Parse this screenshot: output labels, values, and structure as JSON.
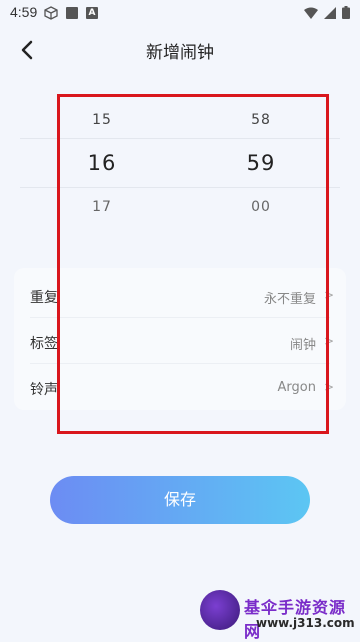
{
  "status_bar": {
    "time": "4:59",
    "icons_left": [
      "cube-icon",
      "square-icon",
      "a-icon"
    ],
    "icons_right": [
      "wifi-icon",
      "signal-icon",
      "battery-icon"
    ],
    "a_icon_letter": "A"
  },
  "header": {
    "title": "新增闹钟",
    "back_icon": "chevron-left-icon"
  },
  "time_picker": {
    "hours": {
      "prev": "15",
      "selected": "16",
      "next": "17"
    },
    "minutes": {
      "prev": "58",
      "selected": "59",
      "next": "00"
    }
  },
  "settings": {
    "repeat": {
      "label": "重复",
      "value": "永不重复"
    },
    "tag": {
      "label": "标签",
      "value": "闹钟"
    },
    "ringtone": {
      "label": "铃声",
      "value": "Argon"
    },
    "chevron": ">"
  },
  "save_button": {
    "label": "保存"
  },
  "watermark": {
    "title": "基伞手游资源网",
    "url": "www.j313.com"
  },
  "colors": {
    "highlight_border": "#d9161d",
    "button_gradient_start": "#6c8cf3",
    "button_gradient_end": "#5cc6f3",
    "background": "#f3f6fc"
  }
}
